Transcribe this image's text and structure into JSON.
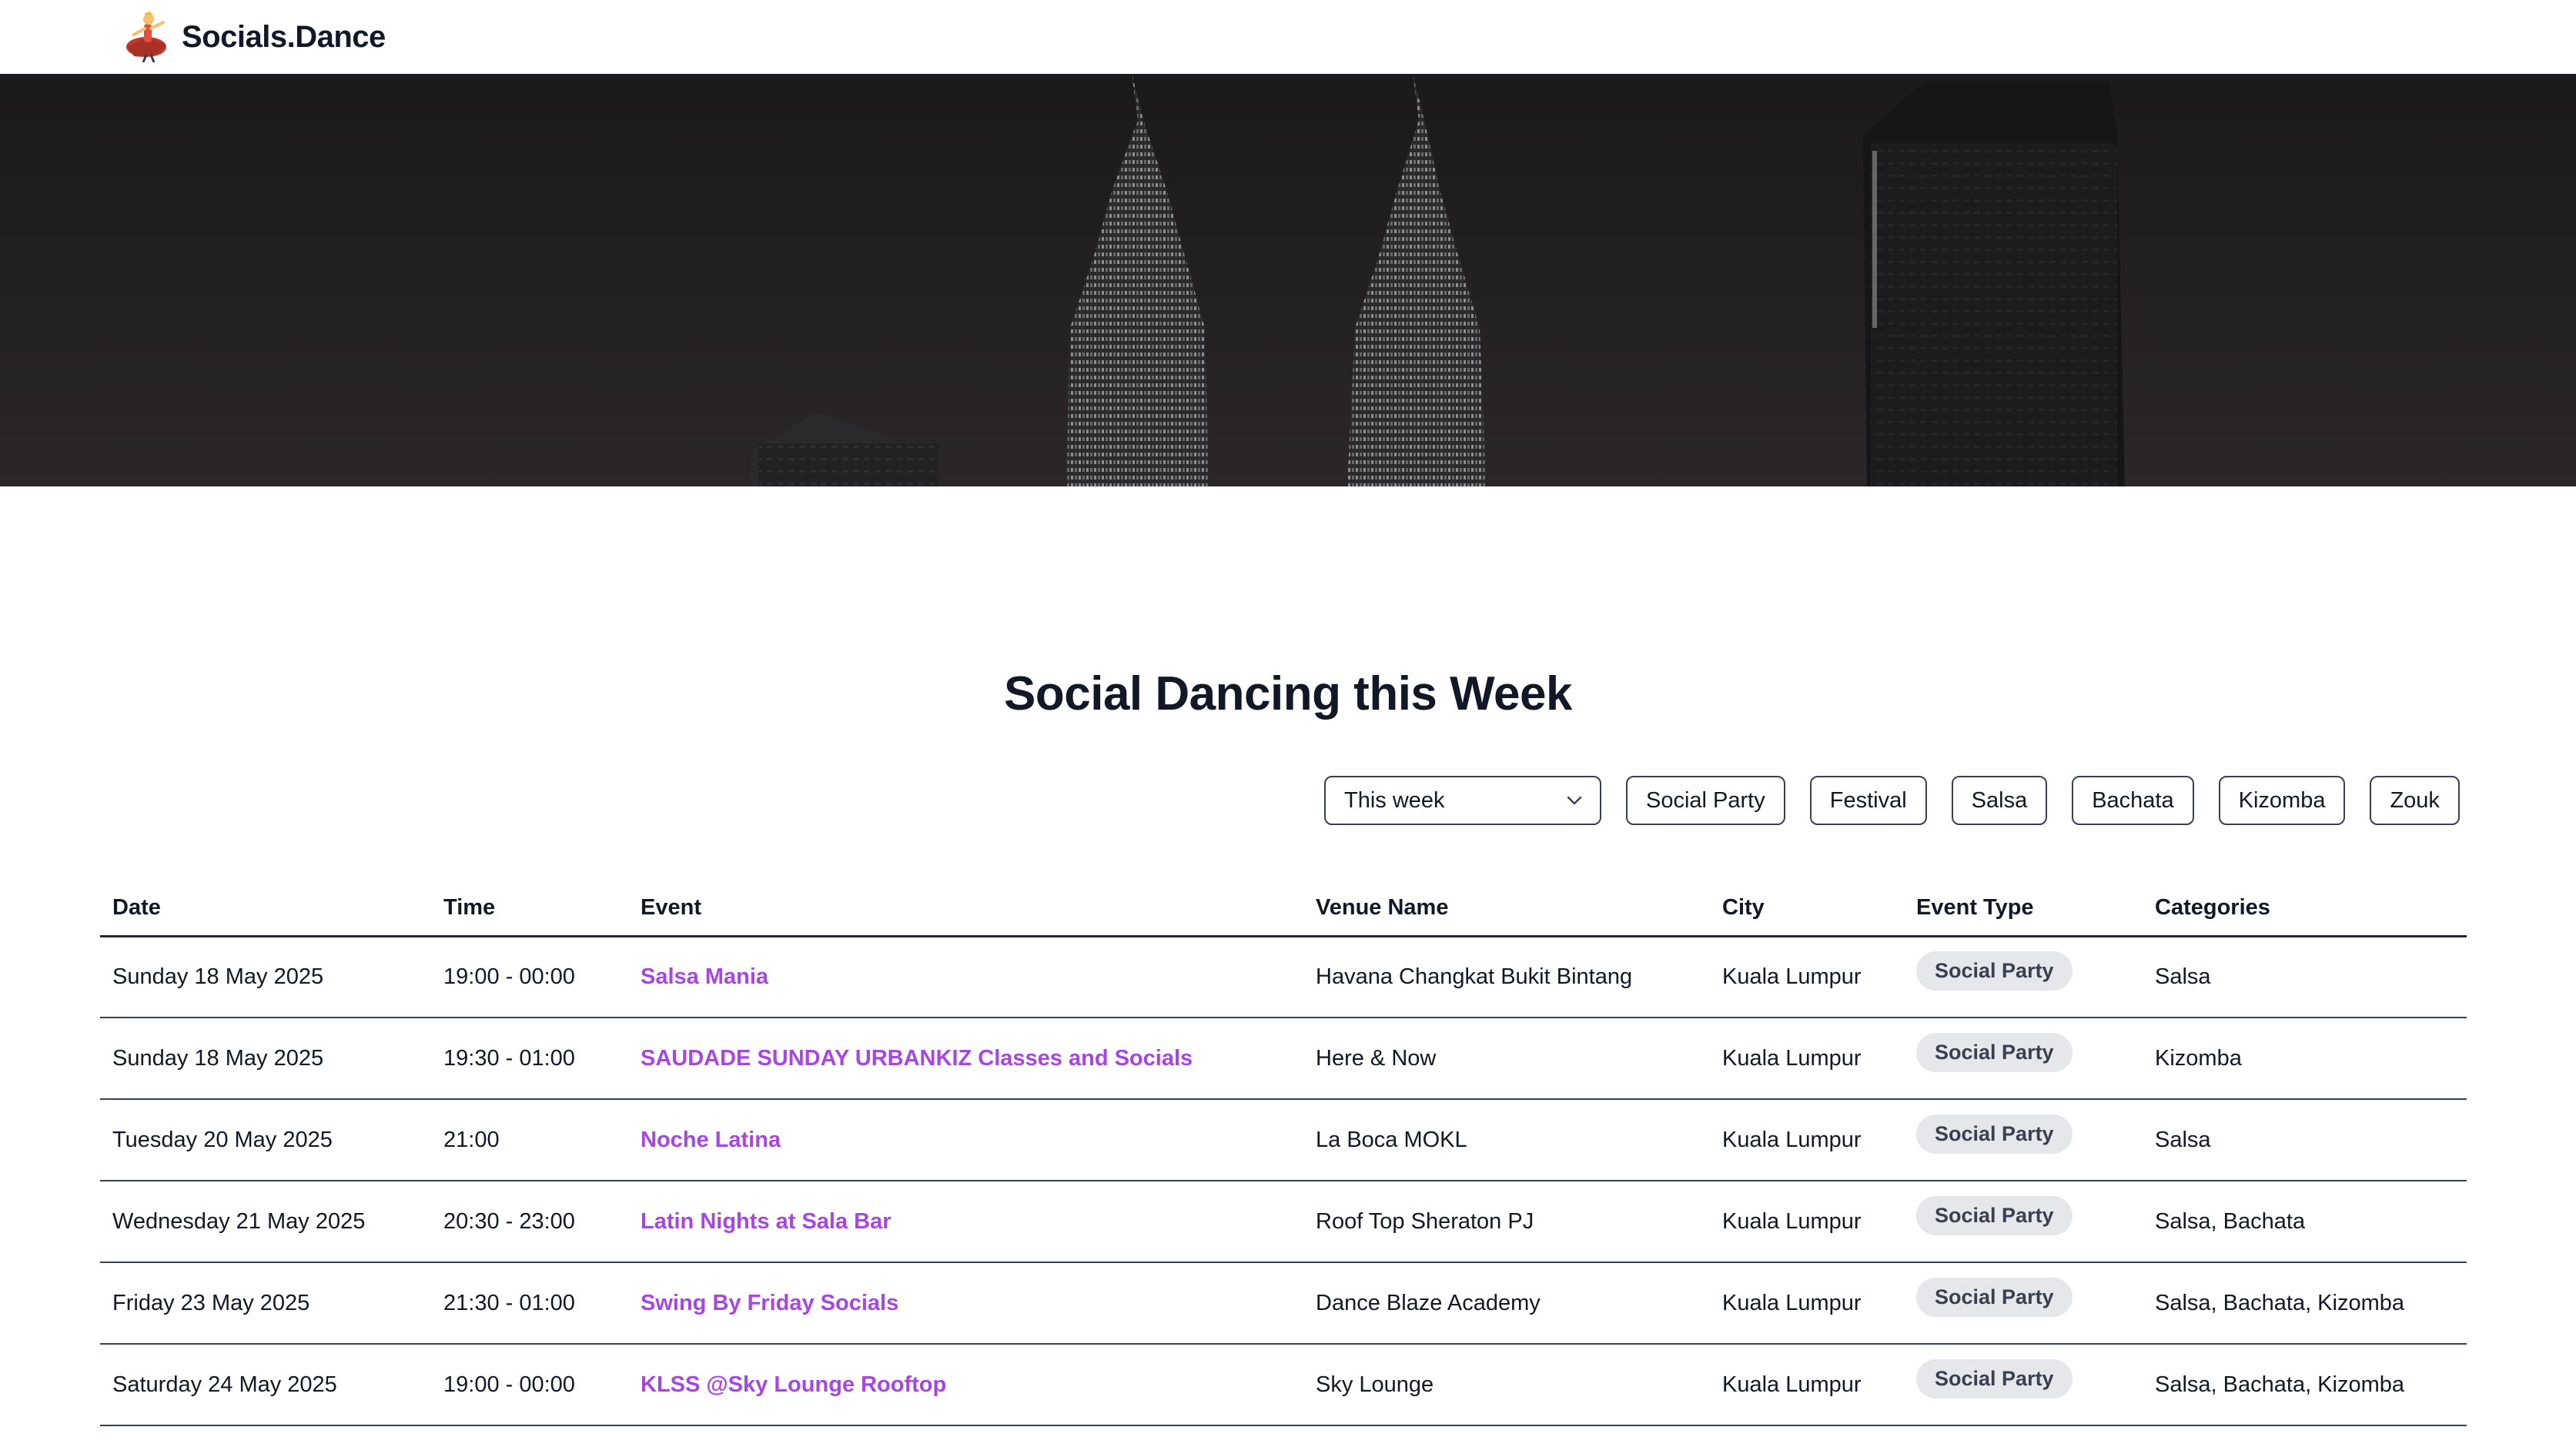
{
  "header": {
    "brand_name": "Socials.Dance",
    "logo_icon": "dancer-logo-icon"
  },
  "hero": {
    "image": "city-skyline-night-image"
  },
  "page": {
    "title": "Social Dancing this Week"
  },
  "filters": {
    "period_select": {
      "value": "This week",
      "icon": "chevron-down-icon"
    },
    "chips": [
      {
        "label": "Social Party"
      },
      {
        "label": "Festival"
      },
      {
        "label": "Salsa"
      },
      {
        "label": "Bachata"
      },
      {
        "label": "Kizomba"
      },
      {
        "label": "Zouk"
      }
    ]
  },
  "table": {
    "columns": [
      "Date",
      "Time",
      "Event",
      "Venue Name",
      "City",
      "Event Type",
      "Categories"
    ],
    "rows": [
      {
        "date": "Sunday 18 May 2025",
        "time": "19:00 - 00:00",
        "event": "Salsa Mania",
        "venue": "Havana Changkat Bukit Bintang",
        "city": "Kuala Lumpur",
        "type": "Social Party",
        "categories": "Salsa"
      },
      {
        "date": "Sunday 18 May 2025",
        "time": "19:30 - 01:00",
        "event": "SAUDADE SUNDAY URBANKIZ Classes and Socials",
        "venue": "Here & Now",
        "city": "Kuala Lumpur",
        "type": "Social Party",
        "categories": "Kizomba"
      },
      {
        "date": "Tuesday 20 May 2025",
        "time": "21:00",
        "event": "Noche Latina",
        "venue": "La Boca MOKL",
        "city": "Kuala Lumpur",
        "type": "Social Party",
        "categories": "Salsa"
      },
      {
        "date": "Wednesday 21 May 2025",
        "time": "20:30 - 23:00",
        "event": "Latin Nights at Sala Bar",
        "venue": "Roof Top Sheraton PJ",
        "city": "Kuala Lumpur",
        "type": "Social Party",
        "categories": "Salsa, Bachata"
      },
      {
        "date": "Friday 23 May 2025",
        "time": "21:30 - 01:00",
        "event": "Swing By Friday Socials",
        "venue": "Dance Blaze Academy",
        "city": "Kuala Lumpur",
        "type": "Social Party",
        "categories": "Salsa, Bachata, Kizomba"
      },
      {
        "date": "Saturday 24 May 2025",
        "time": "19:00 - 00:00",
        "event": "KLSS @Sky Lounge Rooftop",
        "venue": "Sky Lounge",
        "city": "Kuala Lumpur",
        "type": "Social Party",
        "categories": "Salsa, Bachata, Kizomba"
      }
    ]
  },
  "colors": {
    "event_link": "#a646e3",
    "badge_bg": "#e5e7eb",
    "text": "#111827"
  }
}
